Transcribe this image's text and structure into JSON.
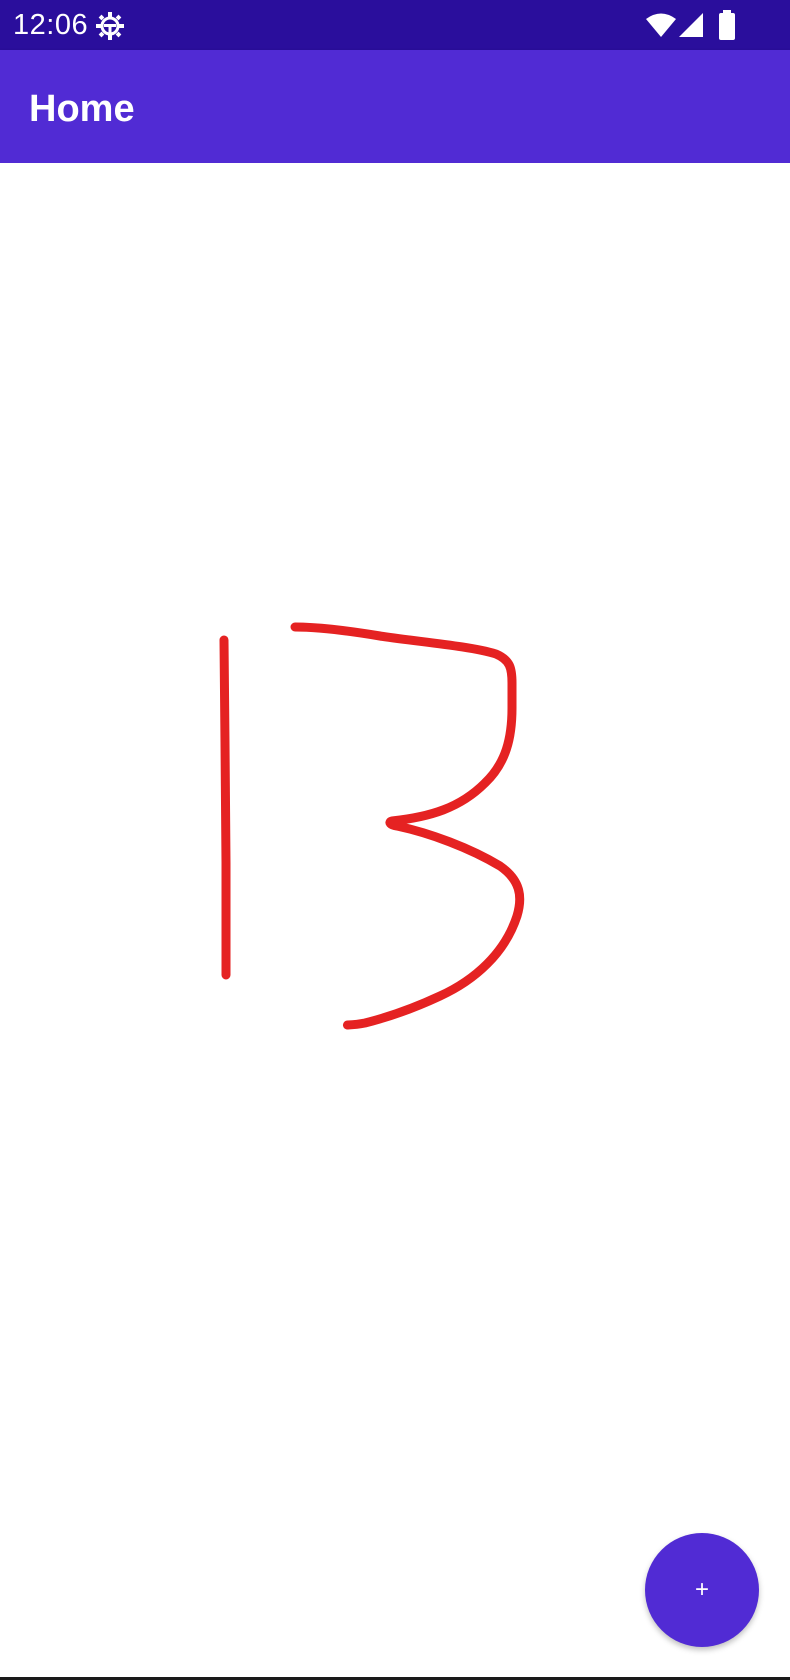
{
  "status_bar": {
    "time": "12:06",
    "icons": [
      "settings-icon",
      "wifi-icon",
      "signal-icon",
      "battery-icon"
    ],
    "background": "#2a0e9c"
  },
  "app_bar": {
    "title": "Home",
    "background": "#512bd4"
  },
  "canvas": {
    "stroke_color": "#e52222",
    "drawing_content": "13"
  },
  "fab": {
    "label": "+",
    "background": "#512bd4"
  }
}
